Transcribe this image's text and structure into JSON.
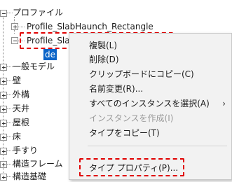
{
  "tree": {
    "profile_root": "プロファイル",
    "profile_child_1": "Profile_SlabHaunch_Rectangle",
    "profile_child_2": "Profile_SlabHaunch_Trapezoid",
    "selected_chip": "de",
    "categories": [
      "一般モデル",
      "壁",
      "外構",
      "天井",
      "屋根",
      "床",
      "手すり",
      "構造フレーム",
      "構造基礎"
    ]
  },
  "context_menu": {
    "items": [
      {
        "label": "複製(L)"
      },
      {
        "label": "削除(D)"
      },
      {
        "label": "クリップボードにコピー(C)"
      },
      {
        "label": "名前変更(R)..."
      },
      {
        "label": "すべてのインスタンスを選択(A)",
        "submenu_glyph": "›"
      },
      {
        "label": "インスタンスを作成(I)",
        "disabled": true
      },
      {
        "label": "タイプをコピー(T)"
      },
      {
        "label": "タイプ プロパティ(P)..."
      }
    ]
  },
  "colors": {
    "highlight_border": "#e00000",
    "selection": "#0a64c8",
    "menu_bg": "#f2f2f2"
  }
}
